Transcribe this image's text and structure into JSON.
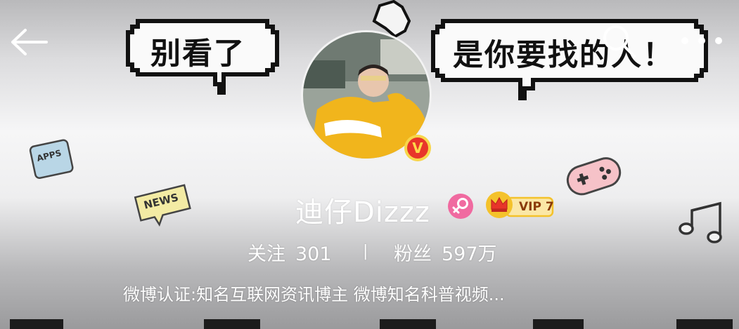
{
  "header": {
    "back_icon": "back-arrow-icon",
    "search_icon": "search-icon",
    "more_icon": "more-dots-icon"
  },
  "cover": {
    "bubble_left_text": "别看了",
    "bubble_right_text": "是你要找的人！",
    "sticker_apps": "APPS",
    "sticker_news": "NEWS"
  },
  "profile": {
    "username": "迪仔Dizzz",
    "verified_mark": "V",
    "gender_icon": "female-icon",
    "vip_label": "VIP 7",
    "following_label": "关注",
    "following_count": "301",
    "divider": "|",
    "followers_label": "粉丝",
    "followers_count": "597万",
    "description": "微博认证:知名互联网资讯博主 微博知名科普视频..."
  },
  "colors": {
    "verified_red": "#e8352a",
    "vip_gold": "#f4c22b",
    "gender_pink": "#f06aa0"
  }
}
